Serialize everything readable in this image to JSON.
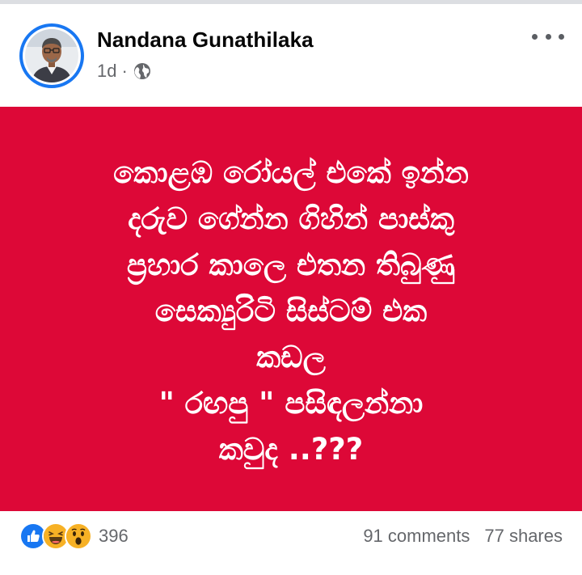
{
  "post": {
    "author": {
      "name": "Nandana Gunathilaka",
      "time": "1d",
      "separator": "·",
      "audience_icon": "globe-icon"
    },
    "more_icon": "more-horizontal-icon",
    "card": {
      "background": "#dd0837",
      "text_color": "#ffffff",
      "lines": [
        "කොළඹ රෝයල් එකේ ඉන්න",
        "දරුව ගේන්න ගිහින් පාස්කු",
        "ප්‍රහාර කාලෙ එතන තිබුණු",
        "සෙක්‍යුරිටි සිස්ටම් එක",
        "කඩල",
        "\" රඟපු \" පසිඳලන්නා",
        "කවුද ..???"
      ]
    },
    "reactions": {
      "icons": [
        "like-icon",
        "haha-icon",
        "wow-icon"
      ],
      "count": "396"
    },
    "comments": "91 comments",
    "shares": "77 shares",
    "colors": {
      "secondary_text": "#65676b",
      "avatar_ring": "#1877f2",
      "like_blue": "#1877f2"
    }
  }
}
